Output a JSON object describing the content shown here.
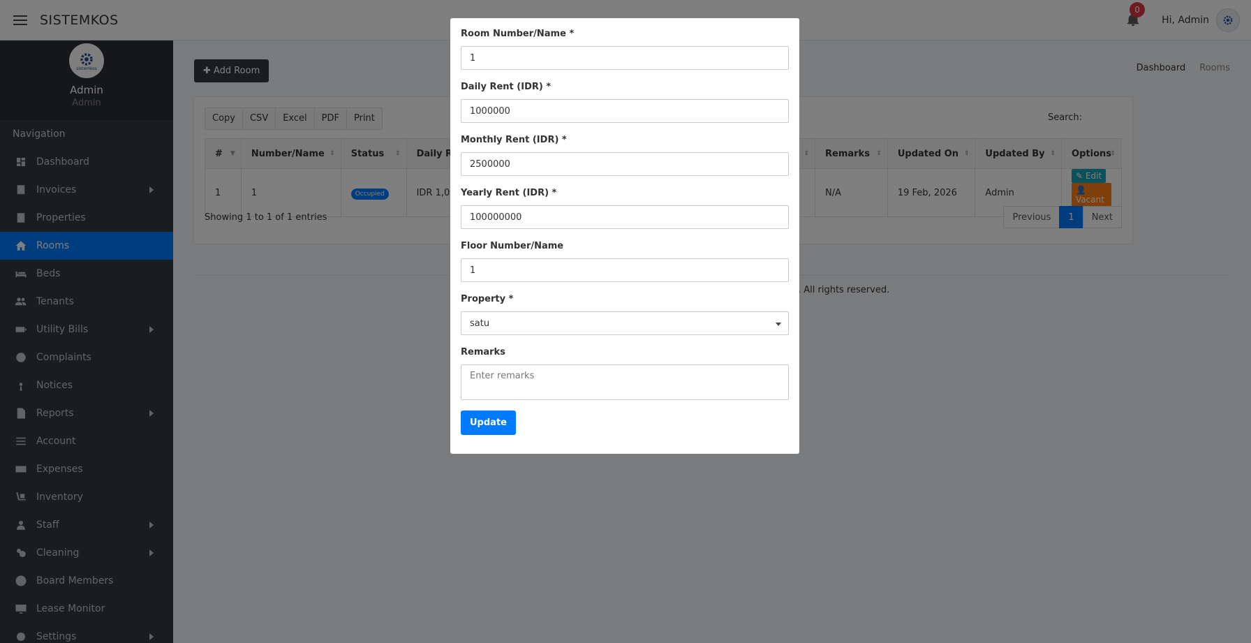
{
  "topbar": {
    "brand": "SISTEMKOS",
    "notification_count": "0",
    "greeting": "Hi, Admin"
  },
  "sidebar": {
    "user_name": "Admin",
    "user_role": "Admin",
    "logo_text": "sistemkos",
    "nav_header": "Navigation",
    "items": [
      {
        "label": "Dashboard",
        "icon": "dashboard-icon"
      },
      {
        "label": "Invoices",
        "icon": "invoice-icon",
        "has_children": true
      },
      {
        "label": "Properties",
        "icon": "building-icon"
      },
      {
        "label": "Rooms",
        "icon": "home-icon",
        "active": true
      },
      {
        "label": "Beds",
        "icon": "bed-icon"
      },
      {
        "label": "Tenants",
        "icon": "users-icon"
      },
      {
        "label": "Utility Bills",
        "icon": "battery-icon",
        "has_children": true
      },
      {
        "label": "Complaints",
        "icon": "lifebuoy-icon"
      },
      {
        "label": "Notices",
        "icon": "podcast-icon"
      },
      {
        "label": "Reports",
        "icon": "file-excel-icon",
        "has_children": true
      },
      {
        "label": "Account",
        "icon": "list-icon"
      },
      {
        "label": "Expenses",
        "icon": "money-icon"
      },
      {
        "label": "Inventory",
        "icon": "dolly-icon"
      },
      {
        "label": "Staff",
        "icon": "user-icon",
        "has_children": true
      },
      {
        "label": "Cleaning",
        "icon": "soap-icon",
        "has_children": true
      },
      {
        "label": "Board Members",
        "icon": "user-circle-icon"
      },
      {
        "label": "Lease Monitor",
        "icon": "desktop-icon"
      },
      {
        "label": "Settings",
        "icon": "settings-icon",
        "has_children": true
      }
    ]
  },
  "content": {
    "add_button": "Add Room",
    "breadcrumb": [
      "Dashboard",
      "Rooms"
    ],
    "export_buttons": [
      "Copy",
      "CSV",
      "Excel",
      "PDF",
      "Print"
    ],
    "search_label": "Search:",
    "columns": [
      "#",
      "Number/Name",
      "Status",
      "Daily Re",
      "Remarks",
      "Updated On",
      "Updated By",
      "Options"
    ],
    "row": {
      "index": "1",
      "name": "1",
      "status": "Occupied",
      "daily": "IDR 1,00",
      "remarks": "N/A",
      "updated_on": "19 Feb, 2026",
      "updated_by": "Admin",
      "edit": "Edit",
      "vacant": "Vacant Room"
    },
    "info": "Showing 1 to 1 of 1 entries",
    "pager": [
      "Previous",
      "1",
      "Next"
    ],
    "footer": ", All rights reserved."
  },
  "modal": {
    "room_label": "Room Number/Name *",
    "room_value": "1",
    "daily_label": "Daily Rent (IDR) *",
    "daily_value": "1000000",
    "monthly_label": "Monthly Rent (IDR) *",
    "monthly_value": "2500000",
    "yearly_label": "Yearly Rent (IDR) *",
    "yearly_value": "100000000",
    "floor_label": "Floor Number/Name",
    "floor_value": "1",
    "property_label": "Property *",
    "property_value": "satu",
    "remarks_label": "Remarks",
    "remarks_placeholder": "Enter remarks",
    "update_button": "Update"
  },
  "colors": {
    "primary": "#007bff",
    "sidebar": "#343a40",
    "danger": "#dc3545",
    "warning": "#fd7e14",
    "info": "#17a2b8"
  }
}
